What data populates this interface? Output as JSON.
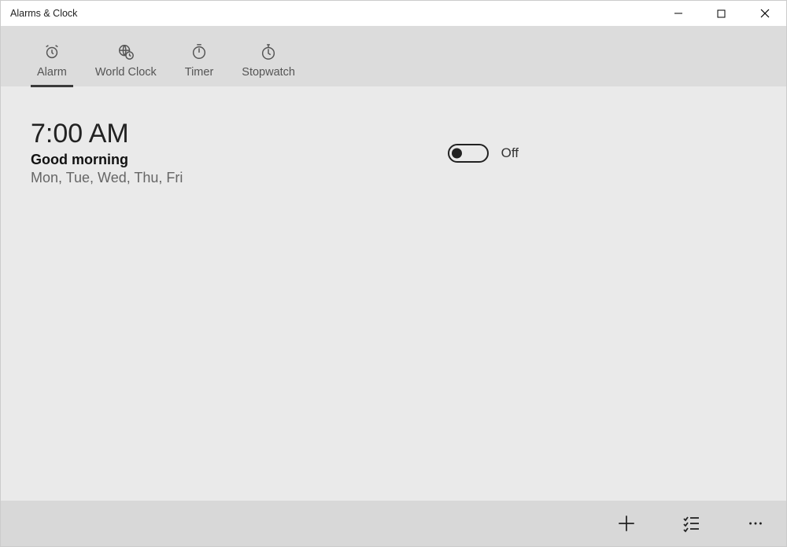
{
  "titlebar": {
    "title": "Alarms & Clock"
  },
  "tabs": {
    "alarm": "Alarm",
    "worldclock": "World Clock",
    "timer": "Timer",
    "stopwatch": "Stopwatch"
  },
  "alarm": {
    "time": "7:00 AM",
    "name": "Good morning",
    "days": "Mon, Tue, Wed, Thu, Fri",
    "toggle_label": "Off",
    "enabled": false
  }
}
